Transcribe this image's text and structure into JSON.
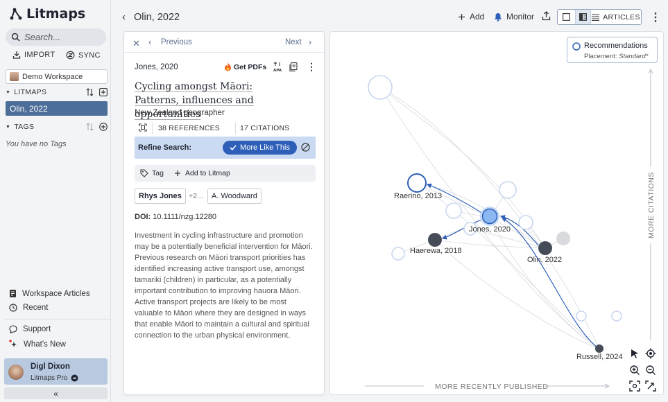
{
  "app": {
    "name": "Litmaps"
  },
  "sidebar": {
    "search_placeholder": "Search...",
    "import_label": "IMPORT",
    "sync_label": "SYNC",
    "workspace": "Demo Workspace",
    "litmaps_header": "LITMAPS",
    "active_litmap": "Olin, 2022",
    "tags_header": "TAGS",
    "no_tags": "You have no Tags",
    "workspace_articles": "Workspace Articles",
    "recent": "Recent",
    "support": "Support",
    "whats_new": "What's New",
    "user_name": "Digl Dixon",
    "user_plan": "Litmaps Pro"
  },
  "topbar": {
    "title": "Olin, 2022",
    "add_label": "Add",
    "monitor_label": "Monitor",
    "articles_label": "ARTICLES"
  },
  "article": {
    "previous_label": "Previous",
    "next_label": "Next",
    "citation": "Jones, 2020",
    "get_pdfs": "Get PDFs",
    "title": "Cycling amongst Māori: Patterns, influences and opportunities",
    "journal": "New Zealand geographer",
    "references_count": "38",
    "references_label": "REFERENCES",
    "citations_count": "17",
    "citations_label": "CITATIONS",
    "refine_label": "Refine Search:",
    "more_like_this": "More Like This",
    "tag_label": "Tag",
    "add_to_litmap": "Add to Litmap",
    "authors": [
      "Rhys Jones",
      "+2...",
      "A. Woodward"
    ],
    "doi_label": "DOI:",
    "doi": "10.1111/nzg.12280",
    "abstract": "Investment in cycling infrastructure and promotion may be a potentially beneficial intervention for Māori. Previous research on Māori transport priorities has identified increasing active transport use, amongst tamariki (children) in particular, as a potentially important contribution to improving hauora Māori. Active transport projects are likely to be most valuable to Māori where they are designed in ways that enable Māori to maintain a cultural and spiritual connection to the urban physical environment."
  },
  "graph": {
    "recommendations_label": "Recommendations",
    "placement_label": "Placement:",
    "placement_value": "Standard*",
    "y_axis_label": "MORE CITATIONS",
    "x_axis_label": "MORE RECENTLY PUBLISHED",
    "labels": {
      "raerino": "Raerino, 2013",
      "jones": "Jones, 2020",
      "haerewa": "Haerewa, 2018",
      "olin": "Olin, 2022",
      "russell": "Russell, 2024"
    },
    "colors": {
      "accent": "#2e5fb8",
      "selected": "#8bb8f0",
      "dark_node": "#454c58"
    }
  }
}
